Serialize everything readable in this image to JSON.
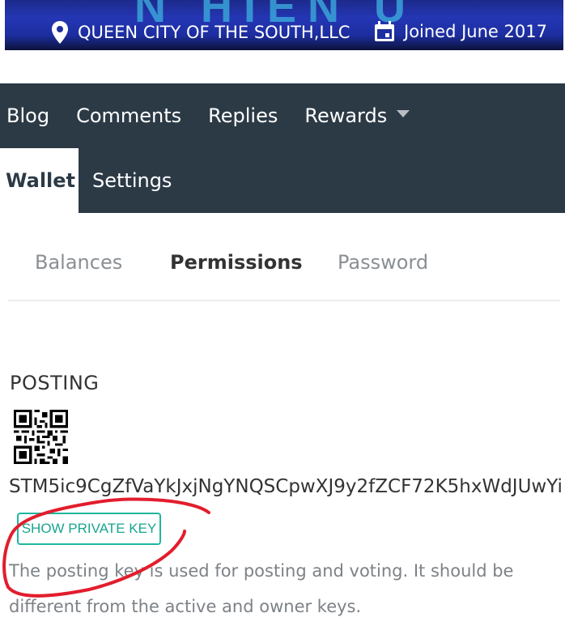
{
  "profile": {
    "location": "QUEEN CITY OF THE SOUTH,LLC",
    "joined": "Joined June 2017",
    "location_icon": "map-pin-icon",
    "joined_icon": "calendar-icon"
  },
  "nav": {
    "items": [
      {
        "label": "Blog"
      },
      {
        "label": "Comments"
      },
      {
        "label": "Replies"
      },
      {
        "label": "Rewards"
      },
      {
        "label": "Wallet"
      },
      {
        "label": "Settings"
      }
    ],
    "active": "Wallet"
  },
  "tabs": {
    "items": [
      {
        "label": "Balances"
      },
      {
        "label": "Permissions"
      },
      {
        "label": "Password"
      }
    ],
    "active": "Permissions"
  },
  "posting": {
    "heading": "POSTING",
    "public_key": "STM5ic9CgZfVaYkJxjNgYNQSCpwXJ9y2fZCF72K5hxWdJUwYi",
    "show_private_key_button": "SHOW PRIVATE KEY",
    "description": "The posting key is used for posting and voting. It should be different from the active and owner keys."
  },
  "colors": {
    "nav_bg": "#2c3a46",
    "accent": "#1fb7a0",
    "annotation": "#e21d2d",
    "banner": "#2436b4"
  }
}
